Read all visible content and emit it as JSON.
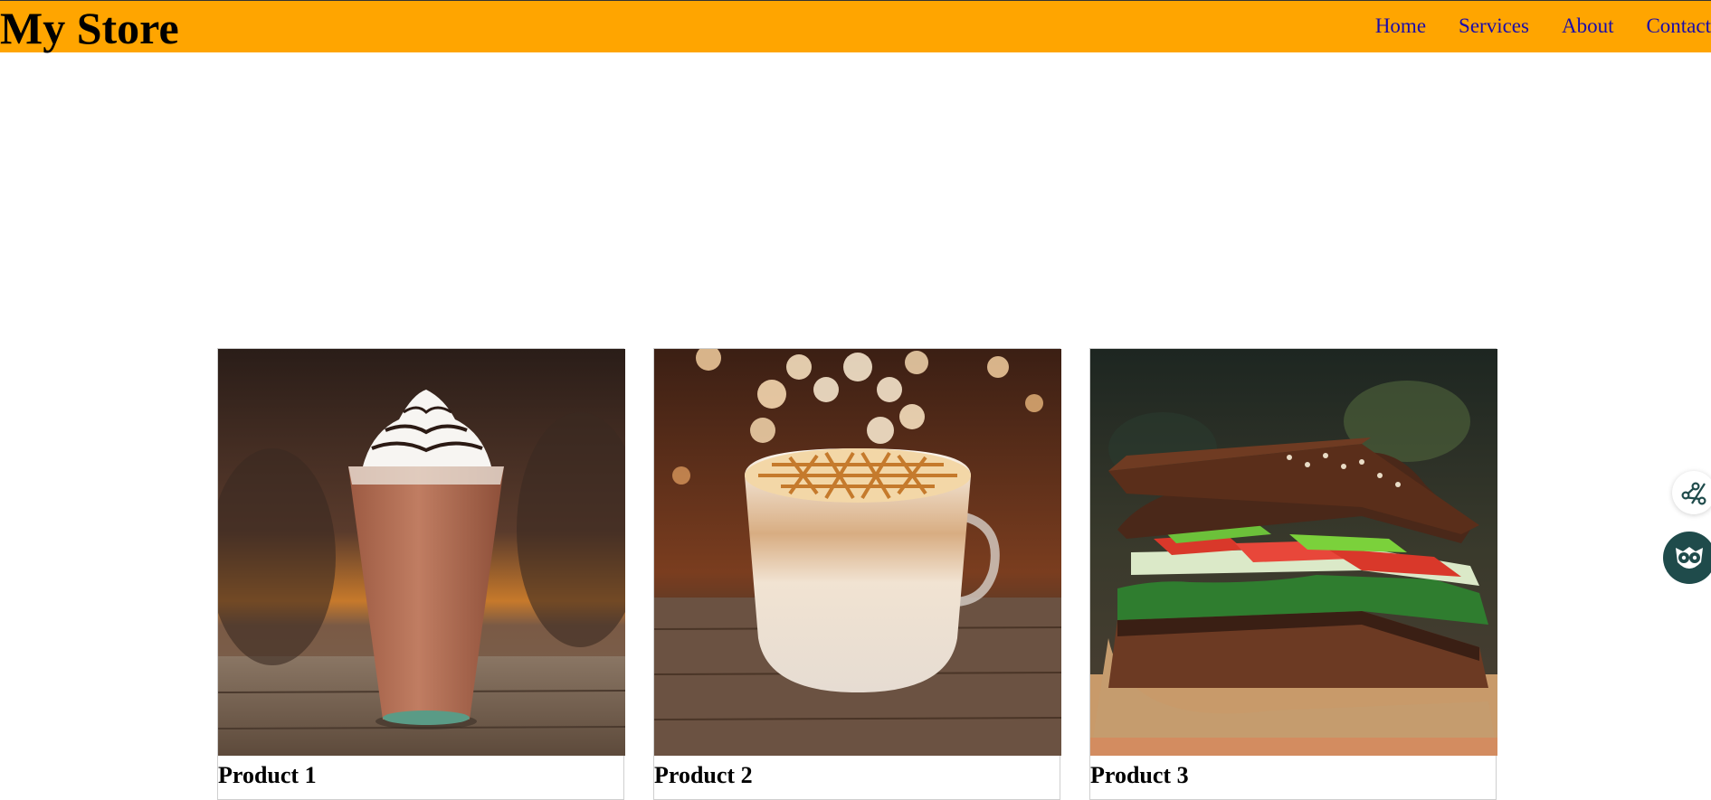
{
  "header": {
    "title": "My Store",
    "background_color": "#FFA500",
    "nav": [
      {
        "label": "Home"
      },
      {
        "label": "Services"
      },
      {
        "label": "About"
      },
      {
        "label": "Contact"
      }
    ],
    "nav_link_color": "#1a0dab"
  },
  "products": [
    {
      "title": "Product 1",
      "image_icon": "iced-mocha-frappuccino-photo"
    },
    {
      "title": "Product 2",
      "image_icon": "caramel-latte-mug-photo"
    },
    {
      "title": "Product 3",
      "image_icon": "brown-bread-sandwich-photo"
    }
  ],
  "floating_widgets": [
    {
      "icon": "share-icon"
    },
    {
      "icon": "owl-icon",
      "color": "#1f4b4b"
    }
  ]
}
